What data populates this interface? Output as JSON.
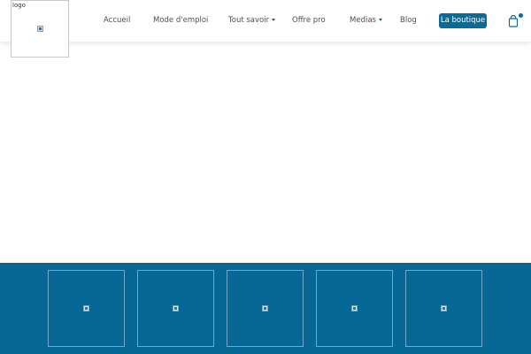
{
  "header": {
    "logo_alt": "logo",
    "nav": {
      "accueil": "Accueil",
      "mode": "Mode d'emploi",
      "tout": "Tout savoir",
      "offre": "Offre pro",
      "medias": "Medias",
      "blog": "Blog"
    },
    "shop_label": "La boutique",
    "cart_icon": "shopping-bag-icon"
  },
  "colors": {
    "brand": "#0b6b98",
    "footer_band": "#076895",
    "header_bg": "#ffffff"
  },
  "footer": {
    "tiles": [
      {
        "icon": "broken-image-icon"
      },
      {
        "icon": "broken-image-icon"
      },
      {
        "icon": "broken-image-icon"
      },
      {
        "icon": "broken-image-icon"
      },
      {
        "icon": "broken-image-icon"
      }
    ]
  }
}
